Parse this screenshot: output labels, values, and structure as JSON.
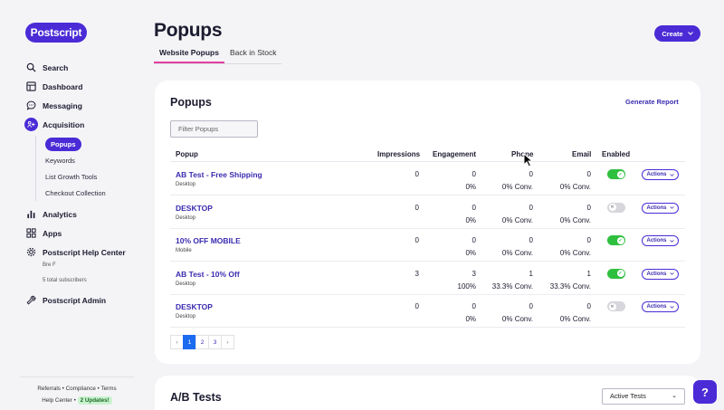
{
  "sidebar": {
    "logo": "Postscript",
    "nav": {
      "search": "Search",
      "dashboard": "Dashboard",
      "messaging": "Messaging",
      "acquisition": "Acquisition",
      "analytics": "Analytics",
      "apps": "Apps",
      "help_center": "Postscript Help Center",
      "user_name": "Bre F",
      "subscribers": "5 total subscribers",
      "admin": "Postscript Admin"
    },
    "subnav": [
      "Popups",
      "Keywords",
      "List Growth Tools",
      "Checkout Collection"
    ],
    "footer": {
      "referrals": "Referrals",
      "compliance": "Compliance",
      "terms": "Terms",
      "sep": "•",
      "help_center": "Help Center",
      "updates": "2 Updates!"
    }
  },
  "header": {
    "title": "Popups",
    "tabs": [
      "Website Popups",
      "Back in Stock"
    ],
    "create_label": "Create"
  },
  "popups_card": {
    "title": "Popups",
    "generate_report": "Generate Report",
    "filter_placeholder": "Filter Popups",
    "columns": [
      "Popup",
      "Impressions",
      "Engagement",
      "Phone",
      "Email",
      "Enabled"
    ],
    "actions_label": "Actions",
    "rows": [
      {
        "name": "AB Test - Free Shipping",
        "device": "Desktop",
        "impressions": "0",
        "engagement": "0",
        "engagement_pct": "0%",
        "phone": "0",
        "phone_conv": "0% Conv.",
        "email": "0",
        "email_conv": "0% Conv.",
        "enabled": true
      },
      {
        "name": "DESKTOP",
        "device": "Desktop",
        "impressions": "0",
        "engagement": "0",
        "engagement_pct": "0%",
        "phone": "0",
        "phone_conv": "0% Conv.",
        "email": "0",
        "email_conv": "0% Conv.",
        "enabled": false
      },
      {
        "name": "10% OFF MOBILE",
        "device": "Mobile",
        "impressions": "0",
        "engagement": "0",
        "engagement_pct": "0%",
        "phone": "0",
        "phone_conv": "0% Conv.",
        "email": "0",
        "email_conv": "0% Conv.",
        "enabled": true
      },
      {
        "name": "AB Test - 10% Off",
        "device": "Desktop",
        "impressions": "3",
        "engagement": "3",
        "engagement_pct": "100%",
        "phone": "1",
        "phone_conv": "33.3% Conv.",
        "email": "1",
        "email_conv": "33.3% Conv.",
        "enabled": true
      },
      {
        "name": "DESKTOP",
        "device": "Desktop",
        "impressions": "0",
        "engagement": "0",
        "engagement_pct": "0%",
        "phone": "0",
        "phone_conv": "0% Conv.",
        "email": "0",
        "email_conv": "0% Conv.",
        "enabled": false
      }
    ],
    "pagination": {
      "prev": "‹",
      "pages": [
        "1",
        "2",
        "3"
      ],
      "next": "›",
      "current": "1"
    }
  },
  "ab_tests_card": {
    "title": "A/B Tests",
    "select_value": "Active Tests"
  },
  "help_button_label": "?",
  "colors": {
    "brand": "#4a2bd6",
    "accent_pink": "#e53fa0",
    "toggle_on": "#2fbf3f",
    "page_active": "#1b6bf0"
  }
}
